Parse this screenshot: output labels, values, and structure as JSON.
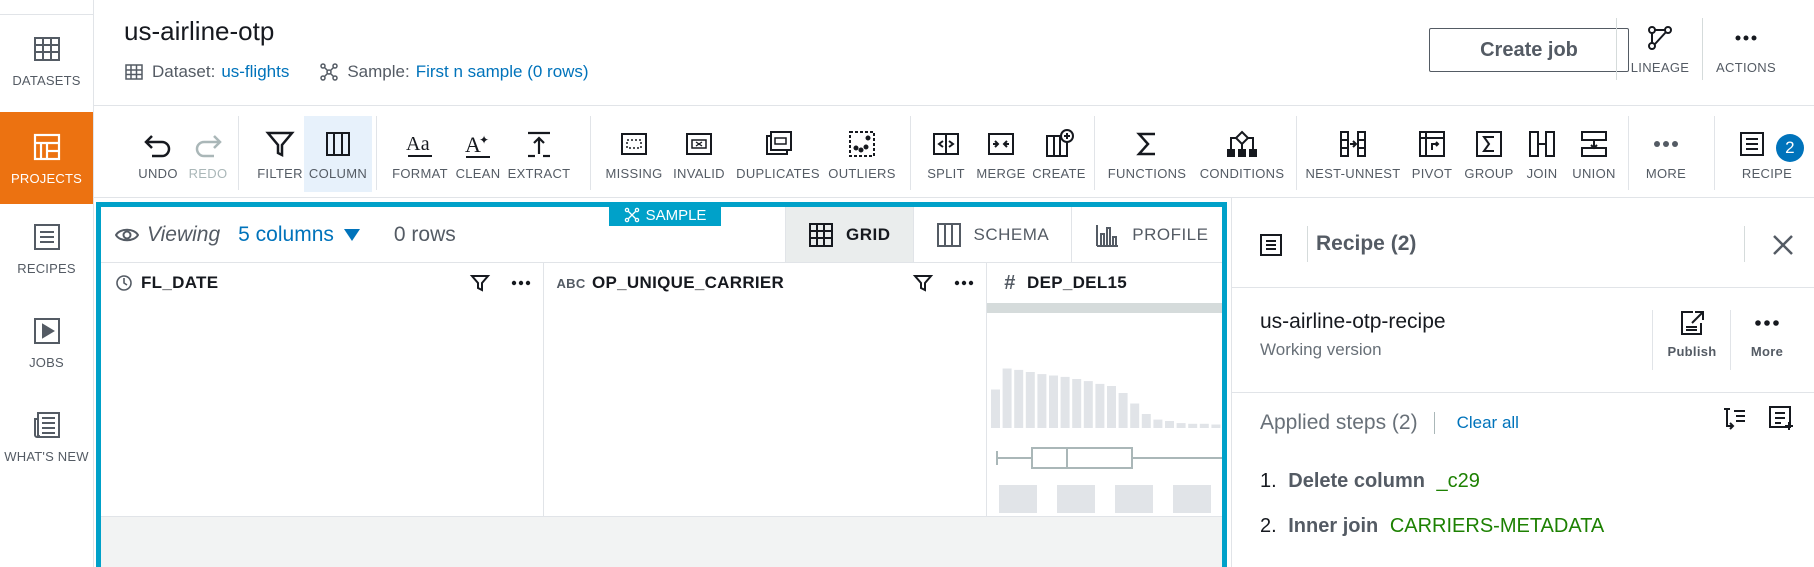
{
  "nav": {
    "items": [
      {
        "label": "DATASETS"
      },
      {
        "label": "PROJECTS"
      },
      {
        "label": "RECIPES"
      },
      {
        "label": "JOBS"
      },
      {
        "label": "WHAT'S NEW"
      }
    ]
  },
  "header": {
    "title": "us-airline-otp",
    "dataset_label": "Dataset:",
    "dataset_value": "us-flights",
    "sample_label": "Sample:",
    "sample_value": "First n sample (0 rows)",
    "create_job": "Create job",
    "lineage": "LINEAGE",
    "actions": "ACTIONS"
  },
  "toolbar": {
    "undo": "UNDO",
    "redo": "REDO",
    "filter": "FILTER",
    "column": "COLUMN",
    "format": "FORMAT",
    "clean": "CLEAN",
    "extract": "EXTRACT",
    "missing": "MISSING",
    "invalid": "INVALID",
    "duplicates": "DUPLICATES",
    "outliers": "OUTLIERS",
    "split": "SPLIT",
    "merge": "MERGE",
    "create": "CREATE",
    "functions": "FUNCTIONS",
    "conditions": "CONDITIONS",
    "nest_unnest": "NEST-UNNEST",
    "pivot": "PIVOT",
    "group": "GROUP",
    "join": "JOIN",
    "union": "UNION",
    "more": "MORE",
    "recipe": "RECIPE",
    "recipe_count": "2"
  },
  "grid": {
    "viewing": "Viewing",
    "columns": "5 columns",
    "rows": "0 rows",
    "sample_tag": "SAMPLE",
    "tabs": [
      "GRID",
      "SCHEMA",
      "PROFILE"
    ],
    "col1": {
      "type_icon": "date-type-icon",
      "name": "FL_DATE"
    },
    "col2": {
      "type_icon": "ABC",
      "name": "OP_UNIQUE_CARRIER"
    },
    "col3": {
      "type_icon": "#",
      "name": "DEP_DEL15"
    },
    "histogram": [
      0.55,
      0.85,
      0.83,
      0.8,
      0.77,
      0.75,
      0.73,
      0.7,
      0.67,
      0.63,
      0.6,
      0.5,
      0.35,
      0.2,
      0.12,
      0.1,
      0.07,
      0.06,
      0.06,
      0.05,
      0.05
    ]
  },
  "recipe": {
    "title": "Recipe (2)",
    "name": "us-airline-otp-recipe",
    "version": "Working version",
    "publish": "Publish",
    "more": "More",
    "applied": "Applied steps (2)",
    "clear_all": "Clear all",
    "steps": [
      {
        "num": "1.",
        "action": "Delete column",
        "target": "_c29"
      },
      {
        "num": "2.",
        "action": "Inner join",
        "target": "CARRIERS-METADATA"
      }
    ]
  }
}
